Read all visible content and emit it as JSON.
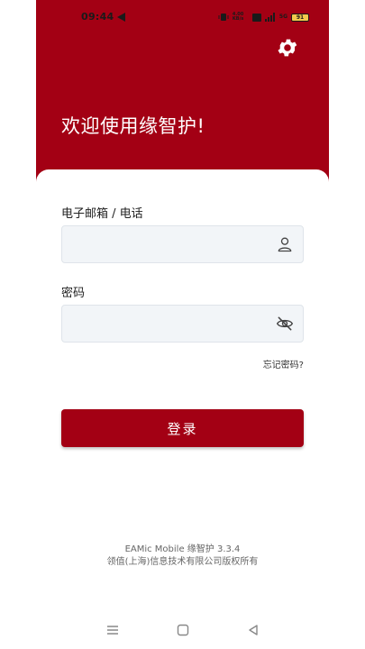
{
  "status_bar": {
    "time": "09:44",
    "network_speed": "4.00 KB/s",
    "network_type": "5G",
    "battery": "91"
  },
  "header": {
    "welcome_text": "欢迎使用缘智护!"
  },
  "form": {
    "email_label": "电子邮箱 / 电话",
    "email_value": "",
    "password_label": "密码",
    "password_value": "",
    "forgot_password": "忘记密码?",
    "login_button": "登录"
  },
  "footer": {
    "version": "EAMic Mobile 缘智护 3.3.4",
    "copyright": "领值(上海)信息技术有限公司版权所有"
  },
  "colors": {
    "brand": "#a30014",
    "input_bg": "#f2f5f8"
  },
  "icons": {
    "settings": "gear-icon",
    "user": "user-icon",
    "visibility": "eye-off-icon"
  }
}
